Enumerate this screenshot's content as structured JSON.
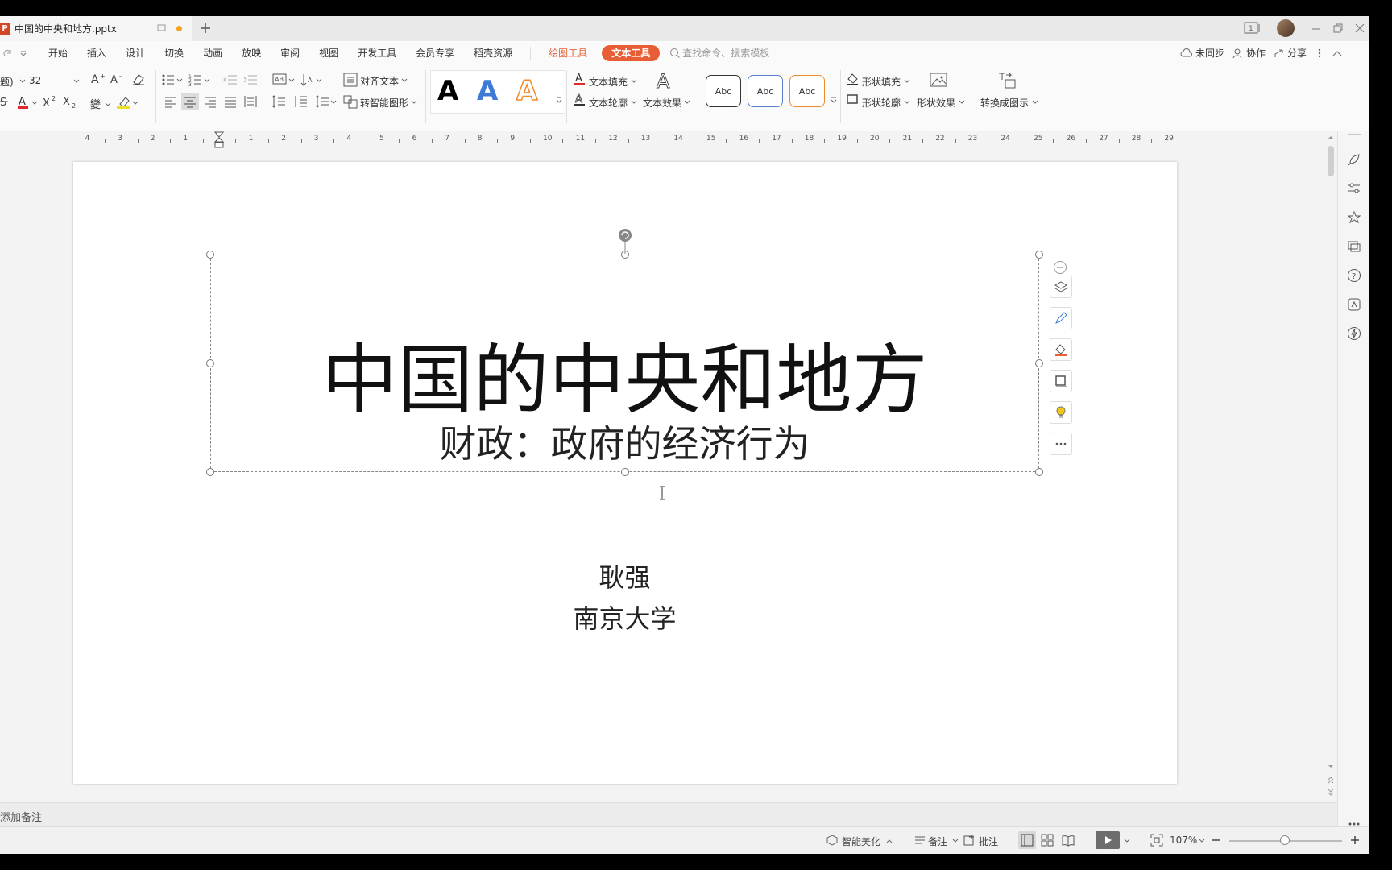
{
  "tab": {
    "filename": "中国的中央和地方.pptx"
  },
  "menu": [
    "开始",
    "插入",
    "设计",
    "切换",
    "动画",
    "放映",
    "审阅",
    "视图",
    "开发工具",
    "会员专享",
    "稻壳资源"
  ],
  "context_tabs": {
    "drawing": "绘图工具",
    "text": "文本工具"
  },
  "search": {
    "placeholder": "查找命令、搜索模板"
  },
  "top_right": {
    "sync": "未同步",
    "collab": "协作",
    "share": "分享"
  },
  "ribbon": {
    "font_name": "题)",
    "font_size": "32",
    "align_text": "对齐文本",
    "smart_shape": "转智能图形",
    "text_fill": "文本填充",
    "text_outline": "文本轮廓",
    "text_effect": "文本效果",
    "shape_fill": "形状填充",
    "shape_outline": "形状轮廓",
    "shape_effect": "形状效果",
    "convert_diagram": "转换成图示",
    "style_sample": "Abc",
    "art_letter": "A",
    "phonetic": "變"
  },
  "ruler": {
    "left_numbers": [
      "4",
      "3",
      "2",
      "1"
    ],
    "right_numbers": [
      "1",
      "2",
      "3",
      "4",
      "5",
      "6",
      "7",
      "8",
      "9",
      "10",
      "11",
      "12",
      "13",
      "14",
      "15",
      "16",
      "17",
      "18",
      "19",
      "20",
      "21",
      "22",
      "23",
      "24",
      "25",
      "26",
      "27",
      "28",
      "29"
    ]
  },
  "slide": {
    "title": "中国的中央和地方",
    "subtitle": "财政：政府的经济行为",
    "author": "耿强",
    "affiliation": "南京大学"
  },
  "notes": {
    "placeholder": "添加备注"
  },
  "status": {
    "beautify": "智能美化",
    "notes": "备注",
    "comment": "批注",
    "zoom": "107%"
  },
  "colors": {
    "accent": "#e85d35",
    "ppt": "#d24726",
    "blue_A": "#3d7bd6",
    "orange_A": "#f08a2c"
  }
}
